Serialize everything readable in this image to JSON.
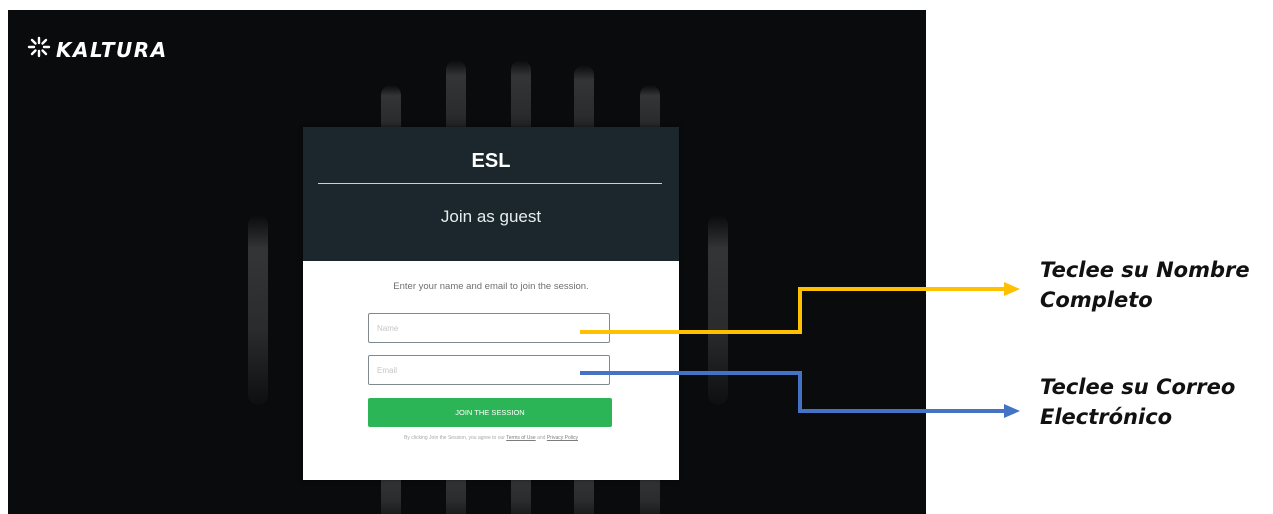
{
  "brand": {
    "name": "KALTURA",
    "logo_icon": "sparkle-icon"
  },
  "card": {
    "title": "ESL",
    "subtitle": "Join as guest",
    "instructions": "Enter your name and email to join the session.",
    "name_placeholder": "Name",
    "email_placeholder": "Email",
    "join_label": "JOIN THE SESSION",
    "terms": {
      "prefix": "By clicking Join the Session, you agree to our",
      "terms_link": "Terms of Use",
      "joiner": "and",
      "privacy_link": "Privacy Policy"
    }
  },
  "annotations": {
    "name_callout": [
      "Teclee su Nombre",
      "Completo"
    ],
    "email_callout": [
      "Teclee su Correo",
      "Electrónico"
    ],
    "name_arrow_color": "#FFC000",
    "email_arrow_color": "#4472C4"
  },
  "colors": {
    "background": "#0A0B0C",
    "card_header": "#1B272C",
    "join_button": "#2CB556"
  }
}
